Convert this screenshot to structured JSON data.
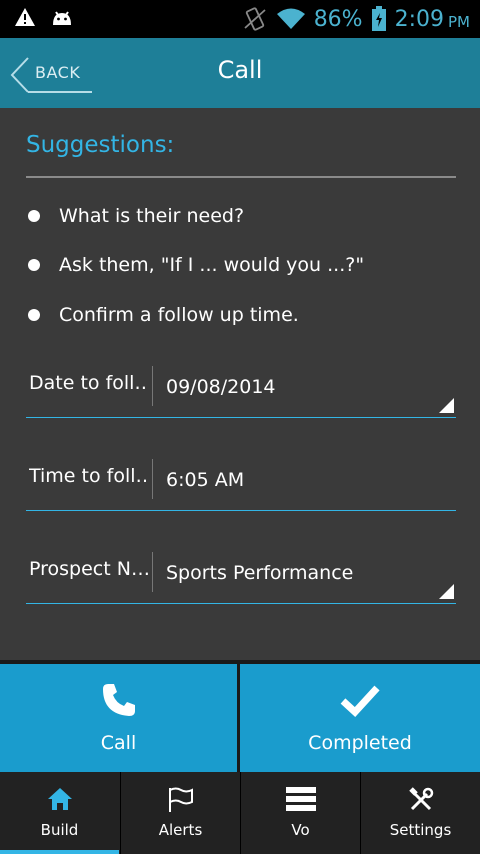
{
  "status_bar": {
    "battery": "86%",
    "time": "2:09",
    "ampm": "PM",
    "icons": [
      "warning-icon",
      "android-icon",
      "vibrate-icon",
      "wifi-icon",
      "battery-icon"
    ]
  },
  "header": {
    "back_label": "BACK",
    "title": "Call"
  },
  "suggestions": {
    "title": "Suggestions:",
    "items": [
      "What is their need?",
      "Ask them, \"If I ... would you ...?\"",
      "Confirm a follow up time."
    ]
  },
  "form": {
    "date": {
      "label": "Date to foll…",
      "value": "09/08/2014"
    },
    "time": {
      "label": "Time to foll…",
      "value": "6:05 AM"
    },
    "prospect": {
      "label": "Prospect N…",
      "value": "Sports Performance"
    }
  },
  "actions": {
    "call_label": "Call",
    "completed_label": "Completed"
  },
  "tabs": {
    "items": [
      {
        "label": "Build",
        "icon": "home-icon"
      },
      {
        "label": "Alerts",
        "icon": "flag-icon"
      },
      {
        "label": "Vo",
        "icon": "list-icon"
      },
      {
        "label": "Settings",
        "icon": "tools-icon"
      }
    ],
    "active": "Build"
  },
  "colors": {
    "accent": "#33b5e5",
    "header": "#1e7f98",
    "action_button": "#1a9ccd",
    "background": "#3a3a3a"
  }
}
